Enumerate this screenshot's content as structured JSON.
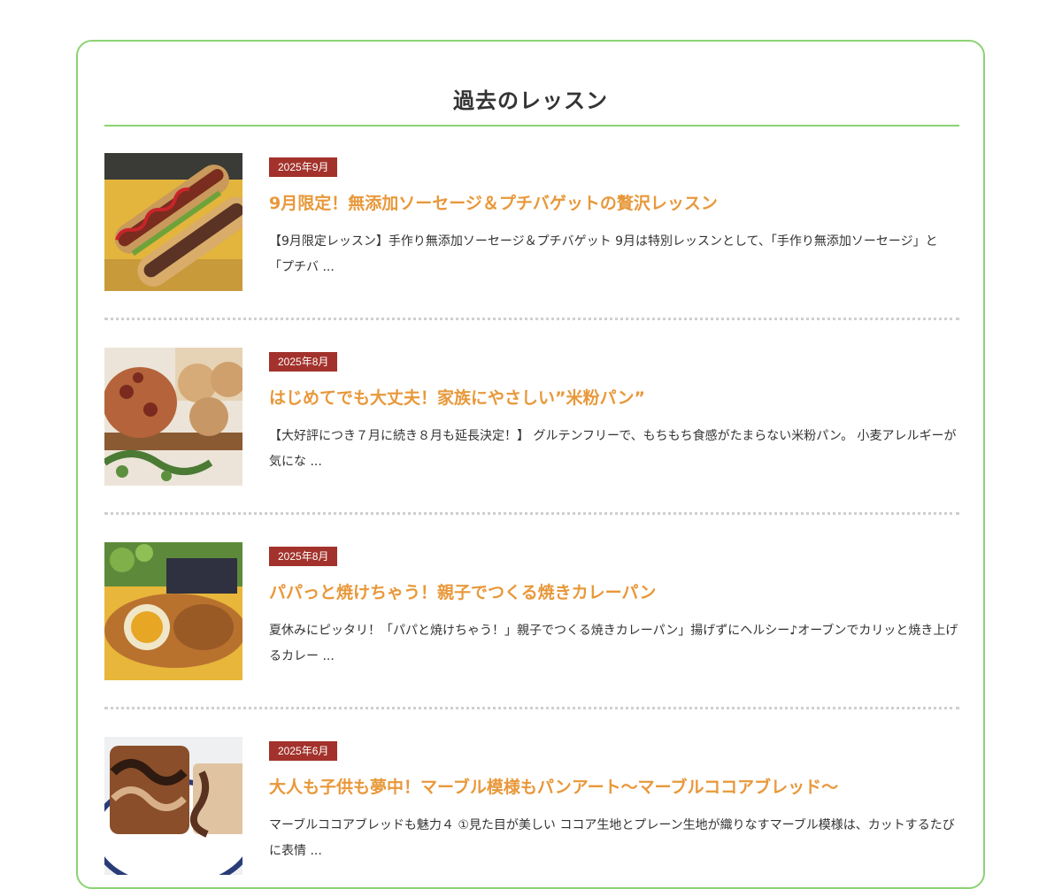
{
  "section": {
    "title": "過去のレッスン"
  },
  "lessons": [
    {
      "date": "2025年9月",
      "title": "9月限定！無添加ソーセージ＆プチバゲットの贅沢レッスン",
      "excerpt": "【9月限定レッスン】手作り無添加ソーセージ＆プチバゲット 9月は特別レッスンとして、「手作り無添加ソーセージ」と「プチバ ...",
      "image": "sausage-baguette-photo"
    },
    {
      "date": "2025年8月",
      "title": "はじめてでも大丈夫！家族にやさしい”米粉パン”",
      "excerpt": "【大好評につき７月に続き８月も延長決定！】 グルテンフリーで、もちもち食感がたまらない米粉パン。 小麦アレルギーが気にな ...",
      "image": "rice-flour-bread-photo"
    },
    {
      "date": "2025年8月",
      "title": "パパっと焼けちゃう！親子でつくる焼きカレーパン",
      "excerpt": "夏休みにピッタリ！「パパと焼けちゃう！」親子でつくる焼きカレーパン」揚げずにヘルシー♪オーブンでカリッと焼き上げるカレー ...",
      "image": "curry-bread-photo"
    },
    {
      "date": "2025年6月",
      "title": "大人も子供も夢中！マーブル模様もパンアート〜マーブルココアブレッド〜",
      "excerpt": "マーブルココアブレッドも魅力４ ①見た目が美しい ココア生地とプレーン生地が織りなすマーブル模様は、カットするたびに表情 ...",
      "image": "marble-cocoa-bread-photo"
    }
  ],
  "colors": {
    "accent_green": "#8cd273",
    "title_orange": "#e8983a",
    "badge_red": "#a2322b"
  }
}
